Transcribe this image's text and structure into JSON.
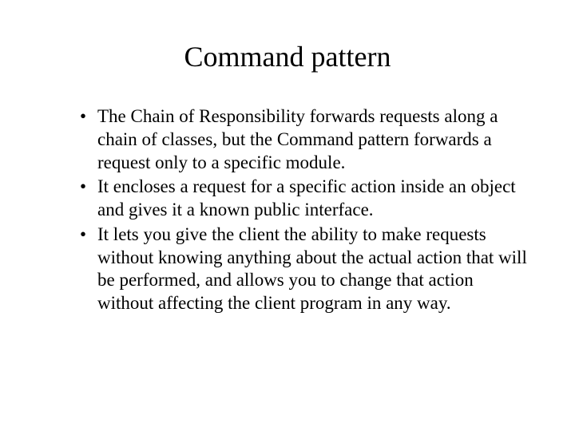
{
  "slide": {
    "title": "Command pattern",
    "bullets": [
      "The Chain of Responsibility forwards requests along a chain of classes, but the Command pattern forwards a request only to a specific module.",
      "It encloses a request for a specific action inside an object and gives it a known public interface.",
      "It lets you give the client the ability to make requests without knowing anything about the actual action that will be performed, and allows you to change that action without affecting the client program in any way."
    ]
  }
}
